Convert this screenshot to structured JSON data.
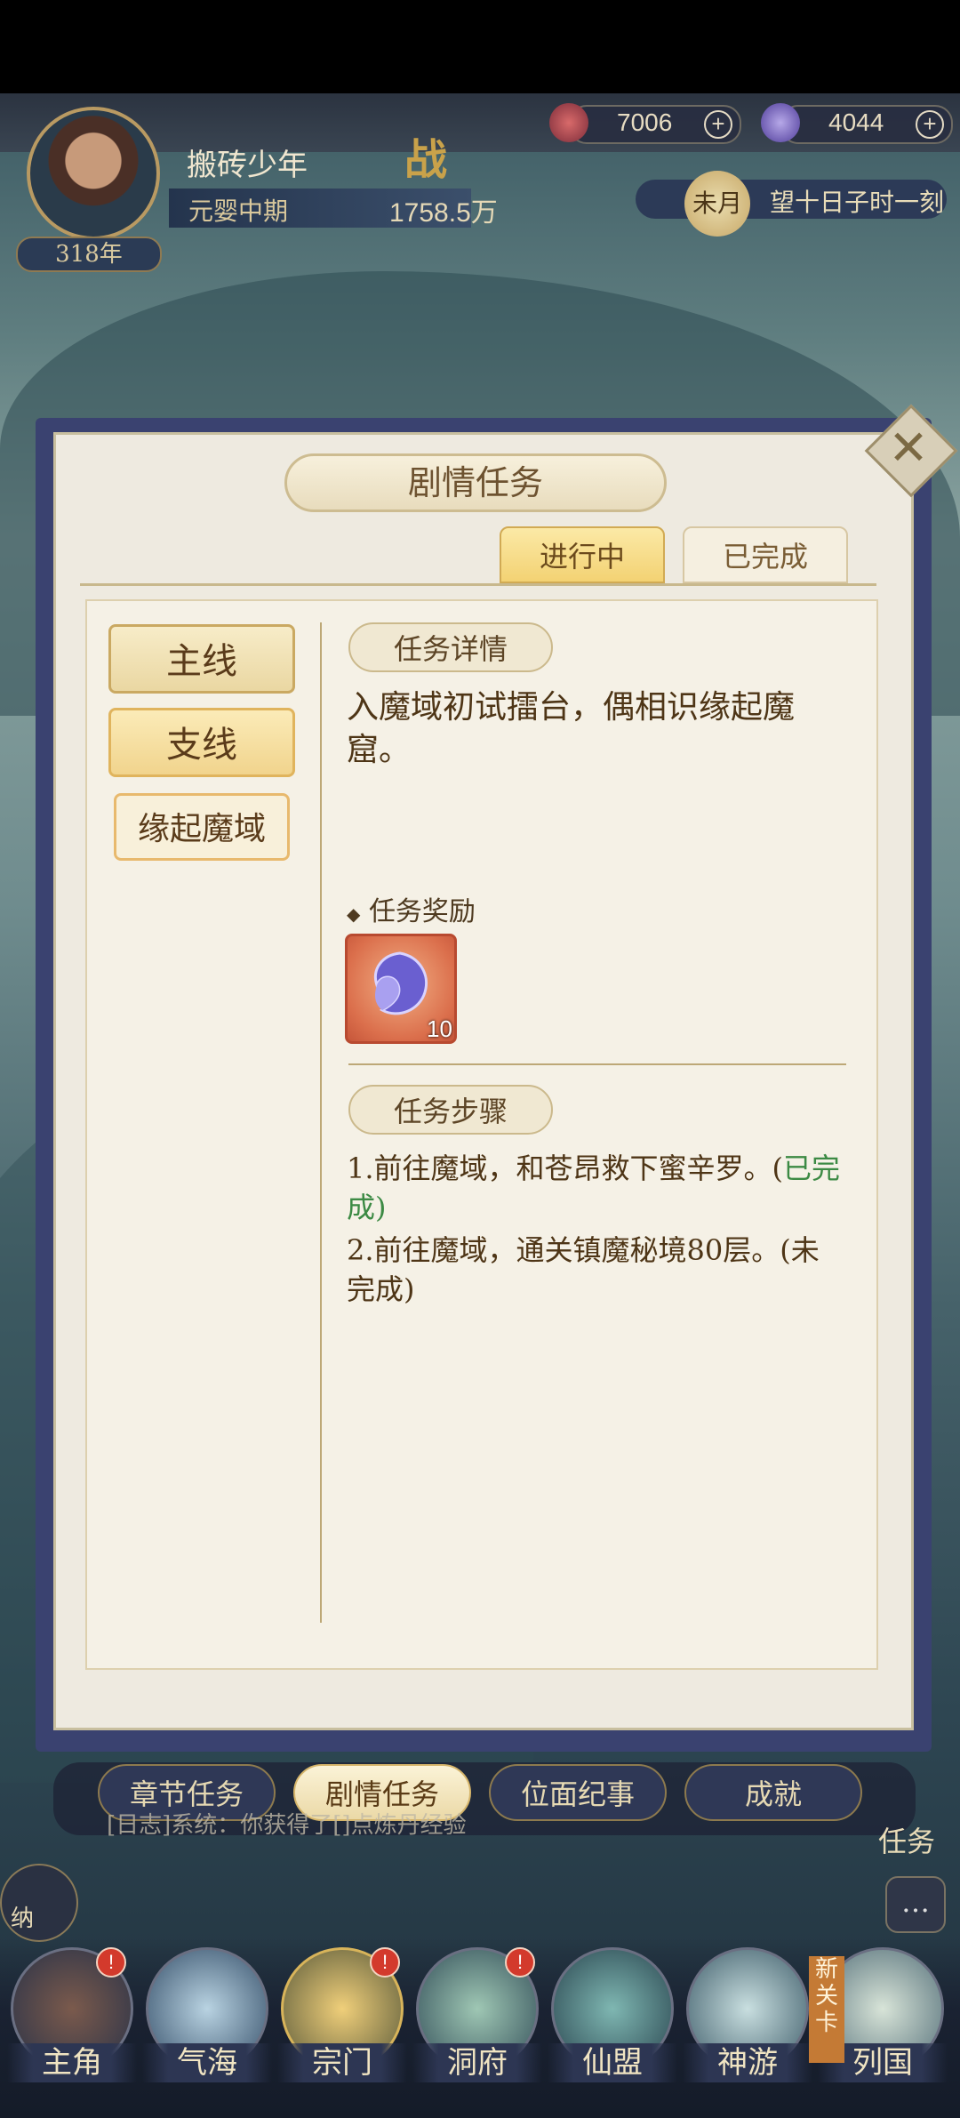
{
  "header": {
    "currency_1": {
      "value": "7006",
      "icon": "spirit-stone-icon",
      "plus": "+"
    },
    "currency_2": {
      "value": "4044",
      "icon": "crystal-icon",
      "plus": "+"
    },
    "player_name": "搬砖少年",
    "realm": "元婴中期",
    "power": "1758.5万",
    "power_badge": "战",
    "age": "318年",
    "moon": "未月",
    "time_text": "望十日子时一刻"
  },
  "panel": {
    "title": "剧情任务",
    "tabs": [
      {
        "label": "进行中",
        "active": true
      },
      {
        "label": "已完成",
        "active": false
      }
    ],
    "categories": [
      {
        "label": "主线"
      },
      {
        "label": "支线"
      },
      {
        "label": "缘起魔域",
        "selected": true
      }
    ],
    "detail_header": "任务详情",
    "description": "入魔域初试擂台，偶相识缘起魔窟。",
    "reward_label": "任务奖励",
    "reward_bullet": "◆",
    "reward_qty": "10",
    "steps_header": "任务步骤",
    "steps": [
      {
        "text": "1.前往魔域，和苍昂救下蜜辛罗。(",
        "status": "已完成)"
      },
      {
        "text": "2.前往魔域，通关镇魔秘境80层。(",
        "status": "未完成)"
      }
    ],
    "close_icon": "close-icon"
  },
  "bottom_tabs": [
    "章节任务",
    "剧情任务",
    "位面纪事",
    "成就"
  ],
  "bottom_tabs_active": 1,
  "log_text": "[日志]系统：你获得了[]点炼丹经验",
  "side_buttons": {
    "task": "任务",
    "na": "纳",
    "chat_icon": "chat-icon"
  },
  "nav": [
    {
      "label": "主角",
      "badge": "!"
    },
    {
      "label": "气海",
      "badge": ""
    },
    {
      "label": "宗门",
      "badge": "!"
    },
    {
      "label": "洞府",
      "badge": "!"
    },
    {
      "label": "仙盟",
      "badge": ""
    },
    {
      "label": "神游",
      "badge": ""
    },
    {
      "label": "列国",
      "badge": ""
    }
  ],
  "new_tag": "新关卡",
  "colors": {
    "panel_border": "#3a4270",
    "accent_gold": "#f3d273",
    "done_green": "#3c8a44"
  }
}
